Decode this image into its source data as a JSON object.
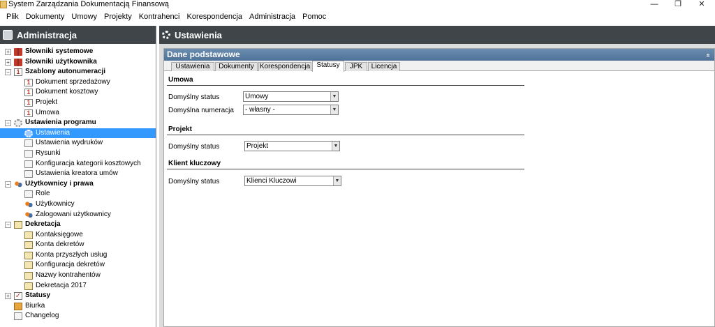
{
  "window": {
    "title": "System Zarządzania Dokumentacją Finansową",
    "minimize": "—",
    "restore": "❐",
    "close": "✕"
  },
  "menu": [
    "Plik",
    "Dokumenty",
    "Umowy",
    "Projekty",
    "Kontrahenci",
    "Korespondencja",
    "Administracja",
    "Pomoc"
  ],
  "left_panel": {
    "title": "Administracja",
    "tree": [
      {
        "label": "Słowniki systemowe",
        "level": 0,
        "expander": "+",
        "icon": "books-icon"
      },
      {
        "label": "Słowniki użytkownika",
        "level": 0,
        "expander": "+",
        "icon": "books-icon"
      },
      {
        "label": "Szablony autonumeracji",
        "level": 0,
        "expander": "−",
        "icon": "numbering-icon"
      },
      {
        "label": "Dokument sprzedażowy",
        "level": 1,
        "icon": "numbering-icon"
      },
      {
        "label": "Dokument kosztowy",
        "level": 1,
        "icon": "numbering-icon"
      },
      {
        "label": "Projekt",
        "level": 1,
        "icon": "numbering-icon"
      },
      {
        "label": "Umowa",
        "level": 1,
        "icon": "numbering-icon"
      },
      {
        "label": "Ustawienia programu",
        "level": 0,
        "expander": "−",
        "icon": "gear-icon"
      },
      {
        "label": "Ustawienia",
        "level": 1,
        "icon": "gear-icon",
        "selected": true
      },
      {
        "label": "Ustawienia wydruków",
        "level": 1,
        "icon": "document-icon"
      },
      {
        "label": "Rysunki",
        "level": 1,
        "icon": "document-icon"
      },
      {
        "label": "Konfiguracja kategorii kosztowych",
        "level": 1,
        "icon": "document-icon"
      },
      {
        "label": "Ustawienia kreatora umów",
        "level": 1,
        "icon": "document-icon"
      },
      {
        "label": "Użytkownicy i prawa",
        "level": 0,
        "expander": "−",
        "icon": "users-icon"
      },
      {
        "label": "Role",
        "level": 1,
        "icon": "document-icon"
      },
      {
        "label": "Użytkownicy",
        "level": 1,
        "icon": "users-icon"
      },
      {
        "label": "Zalogowani użytkownicy",
        "level": 1,
        "icon": "users-icon"
      },
      {
        "label": "Dekretacja",
        "level": 0,
        "expander": "−",
        "icon": "decree-icon"
      },
      {
        "label": "Kontaksięgowe",
        "level": 1,
        "icon": "decree-icon"
      },
      {
        "label": "Konta dekretów",
        "level": 1,
        "icon": "decree-icon"
      },
      {
        "label": "Konta przyszłych usług",
        "level": 1,
        "icon": "decree-icon"
      },
      {
        "label": "Konfiguracja dekretów",
        "level": 1,
        "icon": "decree-icon"
      },
      {
        "label": "Nazwy kontrahentów",
        "level": 1,
        "icon": "decree-icon"
      },
      {
        "label": "Dekretacja 2017",
        "level": 1,
        "icon": "decree-icon"
      },
      {
        "label": "Statusy",
        "level": 0,
        "expander": "+",
        "icon": "checkbox-icon"
      },
      {
        "label": "Biurka",
        "level": 0,
        "icon": "desk-icon",
        "plain": true
      },
      {
        "label": "Changelog",
        "level": 0,
        "icon": "document-icon",
        "plain": true
      }
    ]
  },
  "right_panel": {
    "title": "Ustawienia",
    "section_title": "Dane podstawowe",
    "collapse_glyph": "»",
    "tabs": [
      "Ustawienia",
      "Dokumenty",
      "Korespondencja",
      "Statusy",
      "JPK",
      "Licencja"
    ],
    "active_tab": "Statusy",
    "groups": [
      {
        "title": "Umowa",
        "fields": [
          {
            "label": "Domyślny status",
            "value": "Umowy"
          },
          {
            "label": "Domyślna numeracja",
            "value": "- własny -"
          }
        ]
      },
      {
        "title": "Projekt",
        "fields": [
          {
            "label": "Domyślny status",
            "value": "Projekt"
          }
        ]
      },
      {
        "title": "Klient kluczowy",
        "fields": [
          {
            "label": "Domyślny status",
            "value": "Klienci Kluczowi"
          }
        ]
      }
    ]
  }
}
